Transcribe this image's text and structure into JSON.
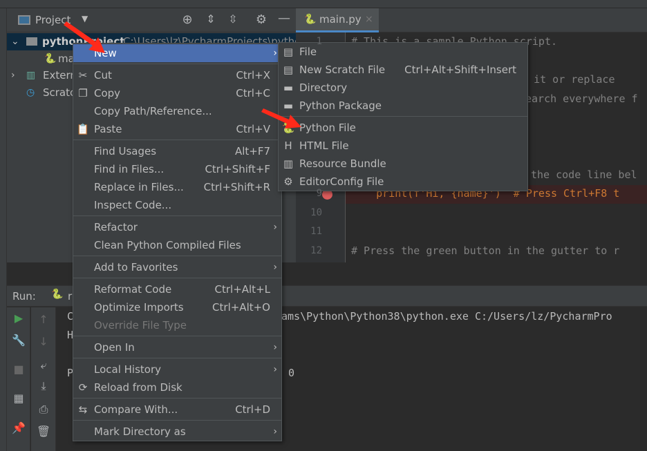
{
  "project_panel": {
    "title": "Project",
    "tree": [
      {
        "label": "pythonProject",
        "path": "C:\\Users\\lz\\PycharmProjects\\pytho"
      },
      {
        "label": "ma"
      },
      {
        "label": "Extern"
      },
      {
        "label": "Scratc"
      }
    ]
  },
  "editor": {
    "tab": "main.py",
    "lines": [
      {
        "n": "1",
        "text": "# This is a sample Python script."
      },
      {
        "n": "",
        "text": "te it or replace"
      },
      {
        "n": "",
        "text": "earch everywhere f"
      },
      {
        "n": "",
        "text": "the code line bel"
      },
      {
        "n": "9",
        "text": "    print(f'Hi, {name}')  # Press Ctrl+F8 t"
      },
      {
        "n": "10",
        "text": ""
      },
      {
        "n": "11",
        "text": ""
      },
      {
        "n": "12",
        "text": "# Press the green button in the gutter to r"
      }
    ]
  },
  "run_panel": {
    "label": "Run:",
    "tab": "r",
    "console": [
      {
        "left": "C",
        "right": "ams\\Python\\Python38\\python.exe C:/Users/lz/PycharmPro"
      },
      {
        "left": "H",
        "right": ""
      },
      {
        "left": "P",
        "right": "0"
      }
    ]
  },
  "context_menu": [
    {
      "label": "New",
      "arrow": true,
      "hl": true
    },
    {
      "sep": true
    },
    {
      "label": "Cut",
      "shortcut": "Ctrl+X",
      "icon": "scissors-icon",
      "glyph": "✂"
    },
    {
      "label": "Copy",
      "shortcut": "Ctrl+C",
      "icon": "copy-icon",
      "glyph": "❐"
    },
    {
      "label": "Copy Path/Reference..."
    },
    {
      "label": "Paste",
      "shortcut": "Ctrl+V",
      "icon": "paste-icon",
      "glyph": "📋"
    },
    {
      "sep": true
    },
    {
      "label": "Find Usages",
      "shortcut": "Alt+F7"
    },
    {
      "label": "Find in Files...",
      "shortcut": "Ctrl+Shift+F"
    },
    {
      "label": "Replace in Files...",
      "shortcut": "Ctrl+Shift+R"
    },
    {
      "label": "Inspect Code..."
    },
    {
      "sep": true
    },
    {
      "label": "Refactor",
      "arrow": true
    },
    {
      "label": "Clean Python Compiled Files"
    },
    {
      "sep": true
    },
    {
      "label": "Add to Favorites",
      "arrow": true
    },
    {
      "sep": true
    },
    {
      "label": "Reformat Code",
      "shortcut": "Ctrl+Alt+L"
    },
    {
      "label": "Optimize Imports",
      "shortcut": "Ctrl+Alt+O"
    },
    {
      "label": "Override File Type",
      "disabled": true
    },
    {
      "sep": true
    },
    {
      "label": "Open In",
      "arrow": true
    },
    {
      "sep": true
    },
    {
      "label": "Local History",
      "arrow": true
    },
    {
      "label": "Reload from Disk",
      "icon": "reload-icon",
      "glyph": "⟳"
    },
    {
      "sep": true
    },
    {
      "label": "Compare With...",
      "shortcut": "Ctrl+D",
      "icon": "compare-icon",
      "glyph": "⇆"
    },
    {
      "sep": true
    },
    {
      "label": "Mark Directory as",
      "arrow": true
    }
  ],
  "new_submenu": [
    {
      "label": "File",
      "icon": "file-icon",
      "glyph": "▤"
    },
    {
      "label": "New Scratch File",
      "shortcut": "Ctrl+Alt+Shift+Insert",
      "icon": "scratch-file-icon",
      "glyph": "▤"
    },
    {
      "label": "Directory",
      "icon": "folder-icon",
      "glyph": "▬"
    },
    {
      "label": "Python Package",
      "icon": "package-icon",
      "glyph": "▬"
    },
    {
      "sep": true
    },
    {
      "label": "Python File",
      "icon": "python-file-icon",
      "glyph": "🐍"
    },
    {
      "label": "HTML File",
      "icon": "html-file-icon",
      "glyph": "H"
    },
    {
      "label": "Resource Bundle",
      "icon": "resource-bundle-icon",
      "glyph": "▥"
    },
    {
      "label": "EditorConfig File",
      "icon": "gear-icon",
      "glyph": "⚙"
    }
  ],
  "colors": {
    "highlight": "#4b6eaf",
    "annotation": "#ff2a1a",
    "accent": "#4a88c7"
  }
}
